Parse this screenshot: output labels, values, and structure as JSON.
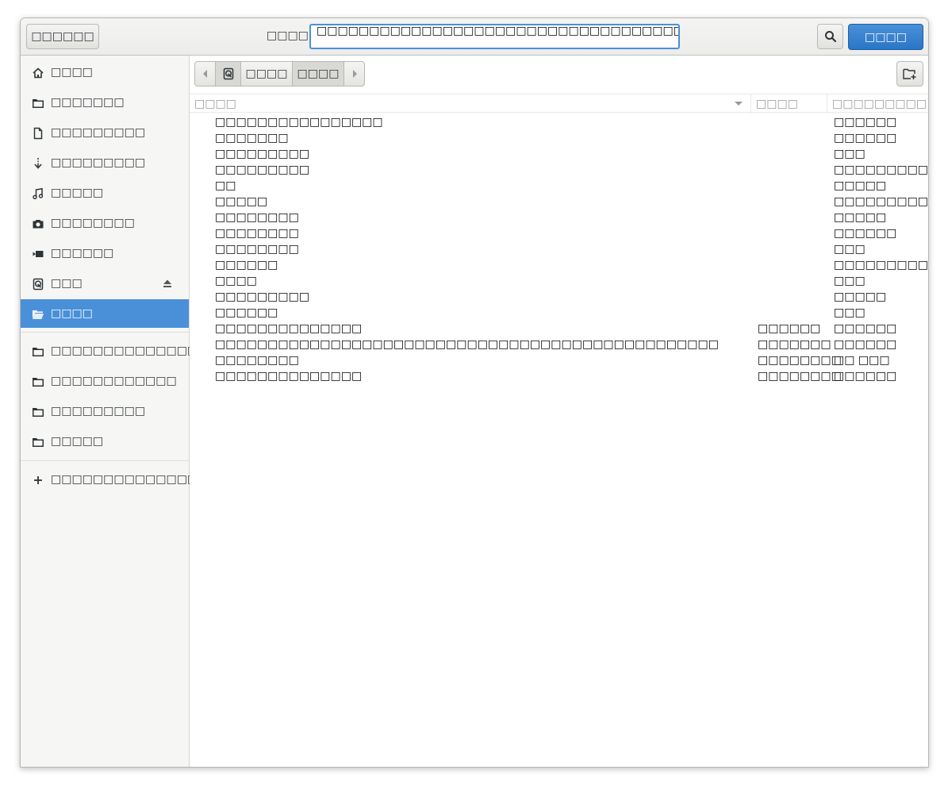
{
  "header": {
    "cancel_label": "□□□□□□",
    "name_label": "□□□□",
    "name_value": "□□□□□□□□□□□□□□□□□□□□□□□□□□□□□□□□□□□□□□□□□□□□□□",
    "open_label": "□□□□"
  },
  "sidebar": {
    "places": [
      {
        "label": "□□□□",
        "icon": "home-icon"
      },
      {
        "label": "□□□□□□□",
        "icon": "folder-icon"
      },
      {
        "label": "□□□□□□□□□",
        "icon": "document-icon"
      },
      {
        "label": "□□□□□□□□□",
        "icon": "download-icon"
      },
      {
        "label": "□□□□□",
        "icon": "music-icon"
      },
      {
        "label": "□□□□□□□□",
        "icon": "camera-icon"
      },
      {
        "label": "□□□□□□",
        "icon": "video-icon"
      },
      {
        "label": "□□□",
        "icon": "disk-icon"
      },
      {
        "label": "□□□□",
        "icon": "folder-icon"
      }
    ],
    "bookmarks": [
      {
        "label": "□□□□□□□□□□□□□□",
        "icon": "folder-icon"
      },
      {
        "label": "□□□□□□□□□□□□",
        "icon": "folder-icon"
      },
      {
        "label": "□□□□□□□□□",
        "icon": "folder-icon"
      },
      {
        "label": "□□□□□",
        "icon": "folder-icon"
      }
    ],
    "other_locations": "□□□□□□□□□□□□□□□□□□□"
  },
  "pathbar": {
    "segments": [
      "□□□□",
      "□□□□"
    ]
  },
  "columns": {
    "name": "□□□□",
    "size": "□□□□",
    "modified": "□□□□□□□□□"
  },
  "files": [
    {
      "name": "□□□□□□□□□□□□□□□□",
      "size": "",
      "modified": "□□□□□□"
    },
    {
      "name": "□□□□□□□",
      "size": "",
      "modified": "□□□□□□"
    },
    {
      "name": "□□□□□□□□□",
      "size": "",
      "modified": "□□□"
    },
    {
      "name": "□□□□□□□□□",
      "size": "",
      "modified": "□□□□□□□□□"
    },
    {
      "name": "□□",
      "size": "",
      "modified": "□□□□□"
    },
    {
      "name": "□□□□□",
      "size": "",
      "modified": "□□□□□□□□□□□"
    },
    {
      "name": "□□□□□□□□",
      "size": "",
      "modified": "□□□□□"
    },
    {
      "name": "□□□□□□□□",
      "size": "",
      "modified": "□□□□□□"
    },
    {
      "name": "□□□□□□□□",
      "size": "",
      "modified": "□□□"
    },
    {
      "name": "□□□□□□",
      "size": "",
      "modified": "□□□□□□□□□□□"
    },
    {
      "name": "□□□□",
      "size": "",
      "modified": "□□□"
    },
    {
      "name": "□□□□□□□□□",
      "size": "",
      "modified": "□□□□□"
    },
    {
      "name": "□□□□□□",
      "size": "",
      "modified": "□□□"
    },
    {
      "name": "□□□□□□□□□□□□□□",
      "size": "□□□□□□",
      "modified": "□□□□□□"
    },
    {
      "name": "□□□□□□□□□□□□□□□□□□□□□□□□□□□□□□□□□□□□□□□□□□□□□□□□",
      "size": "□□□□□□□",
      "modified": "□□□□□□"
    },
    {
      "name": "□□□□□□□□",
      "size": "□□□□□□□□",
      "modified": "□□ □□□"
    },
    {
      "name": "□□□□□□□□□□□□□□",
      "size": "□□□□□□□□",
      "modified": "□□□□□□"
    }
  ]
}
